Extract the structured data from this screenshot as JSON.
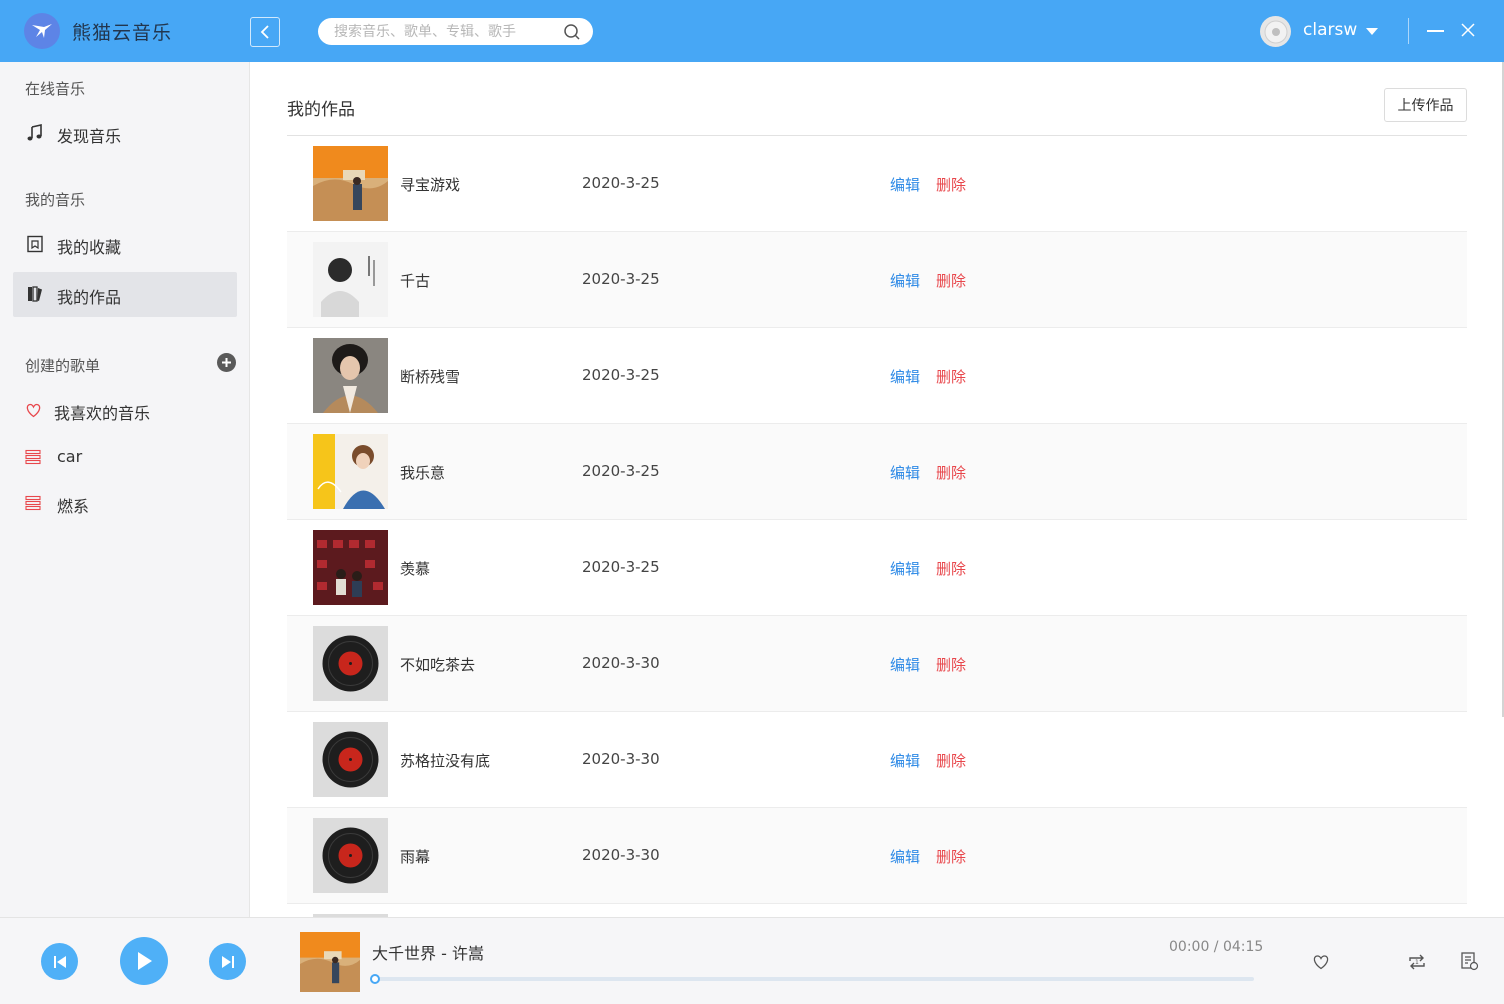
{
  "app": {
    "title": "熊猫云音乐"
  },
  "search": {
    "placeholder": "搜索音乐、歌单、专辑、歌手"
  },
  "user": {
    "name": "clarsw"
  },
  "sidebar": {
    "section_online": "在线音乐",
    "discover_label": "发现音乐",
    "section_my_music": "我的音乐",
    "favorites_label": "我的收藏",
    "my_works_label": "我的作品",
    "section_created_playlists": "创建的歌单",
    "playlists": [
      {
        "label": "我喜欢的音乐",
        "icon": "heart-icon"
      },
      {
        "label": "car",
        "icon": "playlist-icon"
      },
      {
        "label": "燃系",
        "icon": "playlist-icon"
      }
    ]
  },
  "main": {
    "title": "我的作品",
    "upload_label": "上传作品",
    "edit_label": "编辑",
    "delete_label": "删除",
    "songs": [
      {
        "name": "寻宝游戏",
        "date": "2020-3-25",
        "cover": "album-orange"
      },
      {
        "name": "千古",
        "date": "2020-3-25",
        "cover": "album-white"
      },
      {
        "name": "断桥残雪",
        "date": "2020-3-25",
        "cover": "album-portrait"
      },
      {
        "name": "我乐意",
        "date": "2020-3-25",
        "cover": "album-yellow"
      },
      {
        "name": "羡慕",
        "date": "2020-3-25",
        "cover": "album-theater"
      },
      {
        "name": "不如吃茶去",
        "date": "2020-3-30",
        "cover": "vinyl"
      },
      {
        "name": "苏格拉没有底",
        "date": "2020-3-30",
        "cover": "vinyl"
      },
      {
        "name": "雨幕",
        "date": "2020-3-30",
        "cover": "vinyl"
      }
    ]
  },
  "player": {
    "now_playing": "大千世界 - 许嵩",
    "time": "00:00 / 04:15",
    "progress": 0,
    "accent": "#47a7f5"
  },
  "colors": {
    "topbar": "#47a7f5",
    "edit": "#2e8ae6",
    "delete": "#e8474c",
    "playlist_icon": "#e8474c"
  }
}
